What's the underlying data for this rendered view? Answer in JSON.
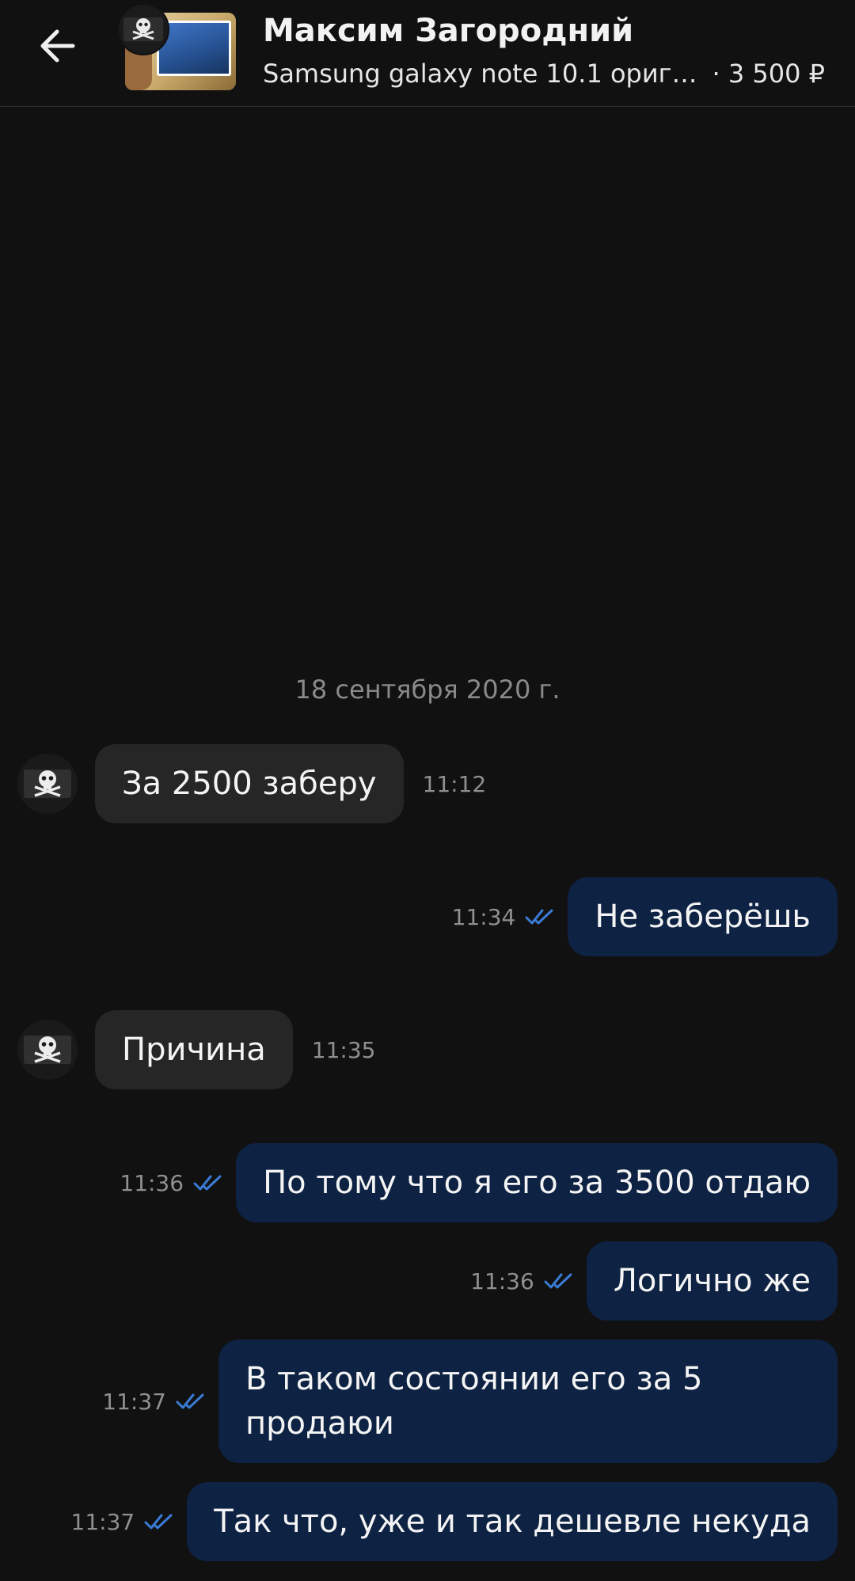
{
  "header": {
    "title": "Максим Загородний",
    "subtitle": "Samsung galaxy note 10.1 оригинальный",
    "price": "· 3 500 ₽",
    "back_icon": "arrow-left-icon",
    "colors": {
      "background": "#111111",
      "incoming_bubble": "#262626",
      "outgoing_bubble": "#0e2243",
      "read_ticks": "#3a7bd5"
    }
  },
  "chat": {
    "date": "18 сентября 2020 г.",
    "messages": [
      {
        "direction": "in",
        "text": "За 2500 заберу",
        "time": "11:12"
      },
      {
        "direction": "out",
        "text": "Не заберёшь",
        "time": "11:34",
        "status": "read"
      },
      {
        "direction": "in",
        "text": "Причина",
        "time": "11:35"
      },
      {
        "direction": "out",
        "text": "По тому что я его за 3500 отдаю",
        "time": "11:36",
        "status": "read"
      },
      {
        "direction": "out",
        "text": "Логично же",
        "time": "11:36",
        "status": "read"
      },
      {
        "direction": "out",
        "text": "В таком состоянии его за 5 продаюи",
        "time": "11:37",
        "status": "read"
      },
      {
        "direction": "out",
        "text": "Так что, уже и так дешевле некуда",
        "time": "11:37",
        "status": "read"
      }
    ]
  }
}
